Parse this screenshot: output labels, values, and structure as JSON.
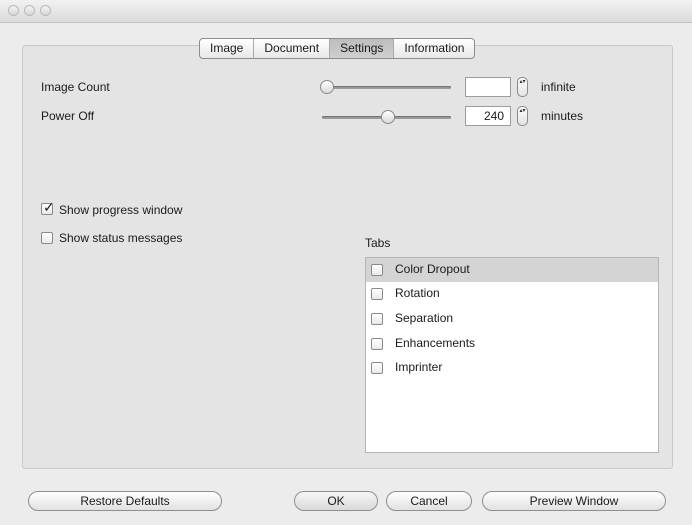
{
  "tabs": [
    "Image",
    "Document",
    "Settings",
    "Information"
  ],
  "active_tab": "Settings",
  "image_count": {
    "label": "Image Count",
    "value": "",
    "unit": "infinite"
  },
  "power_off": {
    "label": "Power Off",
    "value": "240",
    "unit": "minutes"
  },
  "options": {
    "show_progress": {
      "label": "Show progress window",
      "checked": true
    },
    "show_status": {
      "label": "Show status messages",
      "checked": false
    }
  },
  "tabs_list": {
    "heading": "Tabs",
    "items": [
      {
        "label": "Color Dropout",
        "checked": false,
        "selected": true
      },
      {
        "label": "Rotation",
        "checked": false,
        "selected": false
      },
      {
        "label": "Separation",
        "checked": false,
        "selected": false
      },
      {
        "label": "Enhancements",
        "checked": false,
        "selected": false
      },
      {
        "label": "Imprinter",
        "checked": false,
        "selected": false
      }
    ]
  },
  "buttons": {
    "restore": "Restore Defaults",
    "ok": "OK",
    "cancel": "Cancel",
    "preview": "Preview Window"
  },
  "colors": {
    "window_bg": "#ececec",
    "selection": "#d4d4d4"
  },
  "checkmark_glyph": "✓",
  "spin_glyph": "▴▾"
}
